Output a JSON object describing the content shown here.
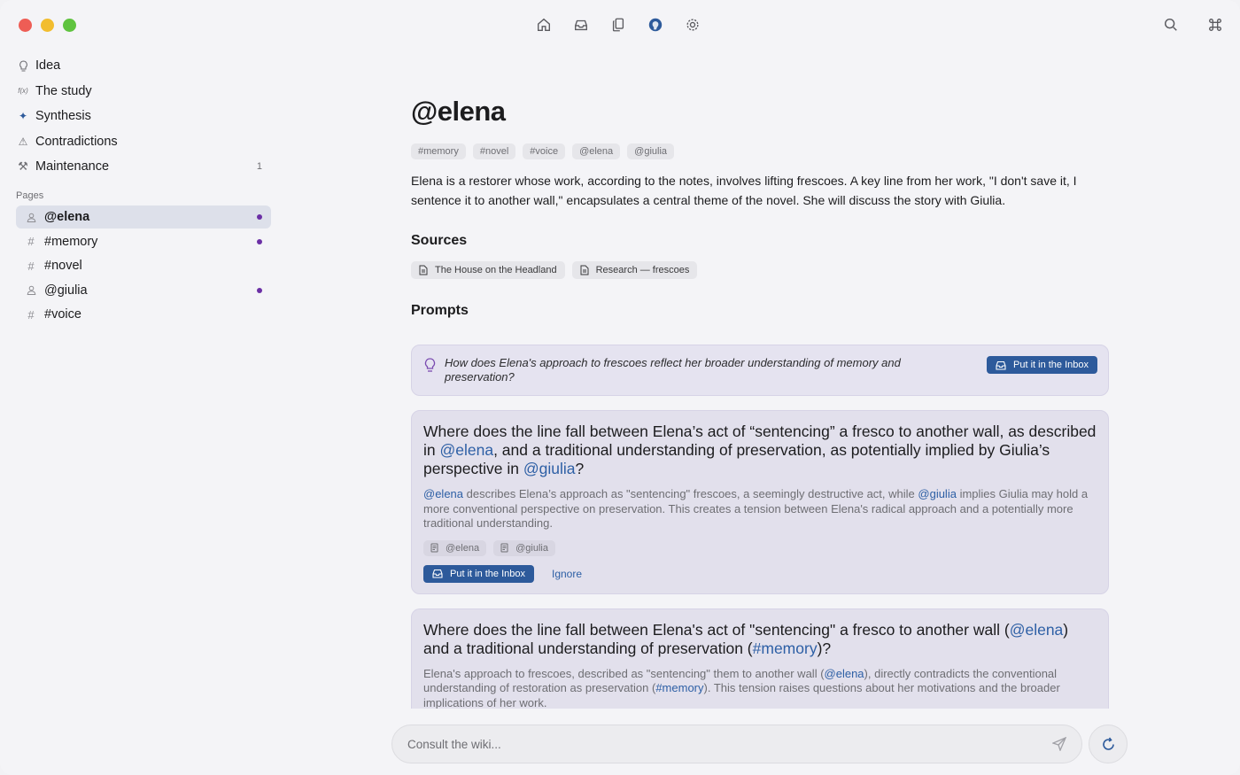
{
  "toolbar": {
    "icons": [
      "home-icon",
      "inbox-icon",
      "documents-icon",
      "brain-icon",
      "settings-icon"
    ],
    "right_icons": [
      "search-icon",
      "command-icon"
    ]
  },
  "sidebar": {
    "items": [
      {
        "label": "Idea",
        "icon": "lightbulb-icon",
        "icon_glyph": "⚉"
      },
      {
        "label": "The study",
        "icon": "function-icon",
        "icon_glyph": "f(x)"
      },
      {
        "label": "Synthesis",
        "icon": "sparkle-icon",
        "icon_glyph": "✦"
      },
      {
        "label": "Contradictions",
        "icon": "warning-icon",
        "icon_glyph": "⚠"
      },
      {
        "label": "Maintenance",
        "icon": "tools-icon",
        "icon_glyph": "⚒",
        "count": "1"
      }
    ],
    "pages_label": "Pages",
    "pages": [
      {
        "label": "@elena",
        "icon": "person-icon",
        "active": true,
        "unread": true
      },
      {
        "label": "#memory",
        "icon": "hash-icon",
        "active": false,
        "unread": true
      },
      {
        "label": "#novel",
        "icon": "hash-icon",
        "active": false,
        "unread": false
      },
      {
        "label": "@giulia",
        "icon": "person-icon",
        "active": false,
        "unread": true
      },
      {
        "label": "#voice",
        "icon": "hash-icon",
        "active": false,
        "unread": false
      }
    ]
  },
  "main": {
    "title": "@elena",
    "tags": [
      "#memory",
      "#novel",
      "#voice",
      "@elena",
      "@giulia"
    ],
    "description": "Elena is a restorer whose work, according to the notes, involves lifting frescoes. A key line from her work, \"I don't save it, I sentence it to another wall,\" encapsulates a central theme of the novel. She will discuss the story with Giulia.",
    "sources_heading": "Sources",
    "sources": [
      "The House on the Headland",
      "Research — frescoes"
    ],
    "prompts_heading": "Prompts",
    "prompt_small": {
      "text": "How does Elena's approach to frescoes reflect her broader understanding of memory and preservation?",
      "button": "Put it in the Inbox"
    },
    "card1": {
      "q1": "Where does the line fall between Elena’s act of “sentencing” a fresco to another wall, as described in ",
      "m1": "@elena",
      "q2": ", and a traditional understanding of preservation, as potentially implied by Giulia’s perspective in ",
      "m2": "@giulia",
      "q3": "?",
      "e_m1": "@elena",
      "e1": " describes Elena’s approach as \"sentencing\" frescoes, a seemingly destructive act, while ",
      "e_m2": "@giulia",
      "e2": " implies Giulia may hold a more conventional perspective on preservation. This creates a tension between Elena's radical approach and a potentially more traditional understanding.",
      "refs": [
        "@elena",
        "@giulia"
      ],
      "button": "Put it in the Inbox",
      "ignore": "Ignore"
    },
    "card2": {
      "q1": "Where does the line fall between Elena's act of \"sentencing\" a fresco to another wall (",
      "m1": "@elena",
      "q2": ") and a traditional understanding of preservation (",
      "m2": "#memory",
      "q3": ")?",
      "e1": "Elena's approach to frescoes, described as \"sentencing\" them to another wall (",
      "e_m1": "@elena",
      "e2": "), directly contradicts the conventional understanding of restoration as preservation (",
      "e_m2": "#memory",
      "e3": "). This tension raises questions about her motivations and the broader implications of her work."
    }
  },
  "chat": {
    "placeholder": "Consult the wiki..."
  },
  "colors": {
    "accent": "#2d5a9b",
    "unread_dot": "#6b2fa5"
  }
}
